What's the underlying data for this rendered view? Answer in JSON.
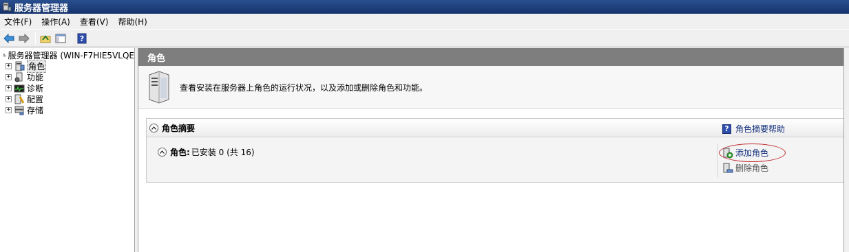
{
  "window": {
    "title": "服务器管理器"
  },
  "menu": {
    "items": [
      "文件(F)",
      "操作(A)",
      "查看(V)",
      "帮助(H)"
    ]
  },
  "toolbar": {
    "buttons": [
      "back-icon",
      "forward-icon",
      "up-folder-icon",
      "show-hide-tree-icon",
      "help-icon"
    ]
  },
  "tree": {
    "root": "服务器管理器 (WIN-F7HIE5VLQE",
    "children": [
      "角色",
      "功能",
      "诊断",
      "配置",
      "存储"
    ],
    "expander": "+"
  },
  "main": {
    "header": "角色",
    "description": "查看安装在服务器上角色的运行状况，以及添加或删除角色和功能。",
    "summary": {
      "title": "角色摘要",
      "help_link": "角色摘要帮助",
      "roles_label": "角色:",
      "roles_value": "已安装 0 (共 16)",
      "actions": {
        "add": "添加角色",
        "remove": "删除角色"
      }
    }
  },
  "colors": {
    "title_bar": "#16336b",
    "header_bar": "#7e7e7e",
    "link": "#14317c",
    "annotation_circle": "#c0282a"
  }
}
